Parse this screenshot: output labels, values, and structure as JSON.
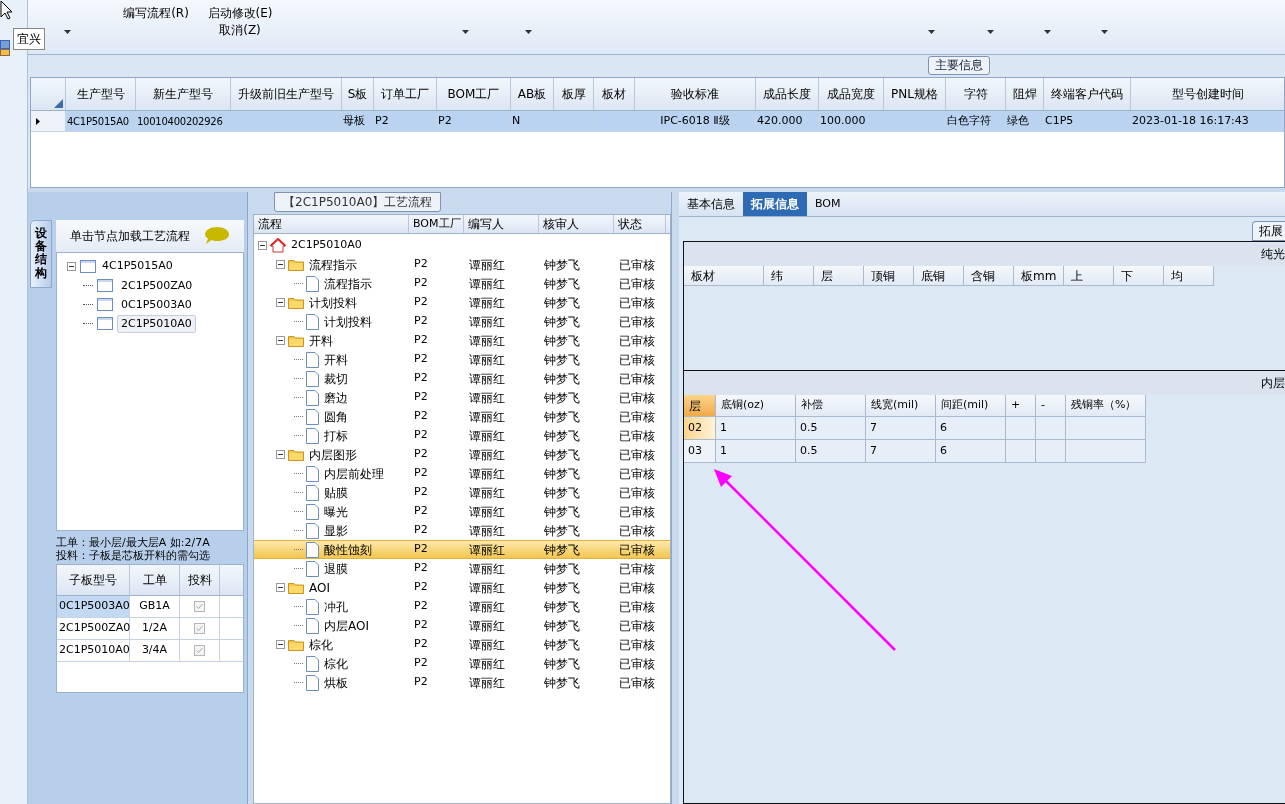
{
  "user_tag": "宜兴",
  "toolbar": {
    "buttons": [
      {
        "label": "编写流程(R)",
        "dropdown": false
      },
      {
        "label": "启动修改(E)",
        "sublabel": "取消(Z)",
        "dropdown": false
      }
    ]
  },
  "main_info": {
    "title": "主要信息",
    "columns": [
      "生产型号",
      "新生产型号",
      "升级前旧生产型号",
      "S板",
      "订单工厂",
      "BOM工厂",
      "AB板",
      "板厚",
      "板材",
      "验收标准",
      "成品长度",
      "成品宽度",
      "PNL规格",
      "字符",
      "阻焊",
      "终端客户代码",
      "型号创建时间"
    ],
    "rows": [
      {
        "selected": true,
        "cells": [
          "4C1P5015A0",
          "10010400202926",
          null,
          "母板",
          "P2",
          "P2",
          "N",
          null,
          null,
          "IPC-6018 Ⅱ级",
          "420.000",
          "100.000",
          null,
          "白色字符",
          "绿色",
          "C1P5",
          "2023-01-18 16:17:43"
        ]
      }
    ]
  },
  "structure_panel": {
    "tab": "设备结构",
    "hint": "单击节点加载工艺流程",
    "tree": [
      {
        "label": "4C1P5015A0",
        "selected": false,
        "expanded": true,
        "children": [
          {
            "label": "2C1P500ZA0",
            "selected": false
          },
          {
            "label": "0C1P5003A0",
            "selected": false
          },
          {
            "label": "2C1P5010A0",
            "selected": true
          }
        ]
      }
    ],
    "notes": [
      "工单：最小层/最大层A 如:2/7A",
      "投料：子板是芯板开料的需勾选"
    ],
    "columns": [
      "子板型号",
      "工单",
      "投料"
    ],
    "rows": [
      {
        "model": "0C1P5003A0",
        "order": "GB1A",
        "feed": true,
        "selected": true
      },
      {
        "model": "2C1P500ZA0",
        "order": "1/2A",
        "feed": true,
        "selected": false
      },
      {
        "model": "2C1P5010A0",
        "order": "3/4A",
        "feed": true,
        "selected": false
      }
    ]
  },
  "process_panel": {
    "title": "【2C1P5010A0】工艺流程",
    "columns": [
      "流程",
      "BOM工厂",
      "编写人",
      "核审人",
      "状态"
    ],
    "tree": [
      {
        "label": "2C1P5010A0",
        "kind": "home",
        "expanded": true,
        "selected": false,
        "children": [
          {
            "label": "流程指示",
            "kind": "folder",
            "expanded": true,
            "selected": false,
            "bom": "P2",
            "writer": "谭丽红",
            "reviewer": "钟梦飞",
            "status": "已审核",
            "children": [
              {
                "label": "流程指示",
                "kind": "doc",
                "selected": false,
                "bom": "P2",
                "writer": "谭丽红",
                "reviewer": "钟梦飞",
                "status": "已审核"
              }
            ]
          },
          {
            "label": "计划投料",
            "kind": "folder",
            "expanded": true,
            "selected": false,
            "bom": "P2",
            "writer": "谭丽红",
            "reviewer": "钟梦飞",
            "status": "已审核",
            "children": [
              {
                "label": "计划投料",
                "kind": "doc",
                "selected": false,
                "bom": "P2",
                "writer": "谭丽红",
                "reviewer": "钟梦飞",
                "status": "已审核"
              }
            ]
          },
          {
            "label": "开料",
            "kind": "folder",
            "expanded": true,
            "selected": false,
            "bom": "P2",
            "writer": "谭丽红",
            "reviewer": "钟梦飞",
            "status": "已审核",
            "children": [
              {
                "label": "开料",
                "kind": "doc",
                "selected": false,
                "bom": "P2",
                "writer": "谭丽红",
                "reviewer": "钟梦飞",
                "status": "已审核"
              },
              {
                "label": "裁切",
                "kind": "doc",
                "selected": false,
                "bom": "P2",
                "writer": "谭丽红",
                "reviewer": "钟梦飞",
                "status": "已审核"
              },
              {
                "label": "磨边",
                "kind": "doc",
                "selected": false,
                "bom": "P2",
                "writer": "谭丽红",
                "reviewer": "钟梦飞",
                "status": "已审核"
              },
              {
                "label": "圆角",
                "kind": "doc",
                "selected": false,
                "bom": "P2",
                "writer": "谭丽红",
                "reviewer": "钟梦飞",
                "status": "已审核"
              },
              {
                "label": "打标",
                "kind": "doc",
                "selected": false,
                "bom": "P2",
                "writer": "谭丽红",
                "reviewer": "钟梦飞",
                "status": "已审核"
              }
            ]
          },
          {
            "label": "内层图形",
            "kind": "folder",
            "expanded": true,
            "selected": false,
            "bom": "P2",
            "writer": "谭丽红",
            "reviewer": "钟梦飞",
            "status": "已审核",
            "children": [
              {
                "label": "内层前处理",
                "kind": "doc",
                "selected": false,
                "bom": "P2",
                "writer": "谭丽红",
                "reviewer": "钟梦飞",
                "status": "已审核"
              },
              {
                "label": "贴膜",
                "kind": "doc",
                "selected": false,
                "bom": "P2",
                "writer": "谭丽红",
                "reviewer": "钟梦飞",
                "status": "已审核"
              },
              {
                "label": "曝光",
                "kind": "doc",
                "selected": false,
                "bom": "P2",
                "writer": "谭丽红",
                "reviewer": "钟梦飞",
                "status": "已审核"
              },
              {
                "label": "显影",
                "kind": "doc",
                "selected": false,
                "bom": "P2",
                "writer": "谭丽红",
                "reviewer": "钟梦飞",
                "status": "已审核"
              },
              {
                "label": "酸性蚀刻",
                "kind": "doc",
                "selected": true,
                "bom": "P2",
                "writer": "谭丽红",
                "reviewer": "钟梦飞",
                "status": "已审核"
              },
              {
                "label": "退膜",
                "kind": "doc",
                "selected": false,
                "bom": "P2",
                "writer": "谭丽红",
                "reviewer": "钟梦飞",
                "status": "已审核"
              }
            ]
          },
          {
            "label": "AOI",
            "kind": "folder",
            "expanded": true,
            "selected": false,
            "bom": "P2",
            "writer": "谭丽红",
            "reviewer": "钟梦飞",
            "status": "已审核",
            "children": [
              {
                "label": "冲孔",
                "kind": "doc",
                "selected": false,
                "bom": "P2",
                "writer": "谭丽红",
                "reviewer": "钟梦飞",
                "status": "已审核"
              },
              {
                "label": "内层AOI",
                "kind": "doc",
                "selected": false,
                "bom": "P2",
                "writer": "谭丽红",
                "reviewer": "钟梦飞",
                "status": "已审核"
              }
            ]
          },
          {
            "label": "棕化",
            "kind": "folder",
            "expanded": true,
            "selected": false,
            "bom": "P2",
            "writer": "谭丽红",
            "reviewer": "钟梦飞",
            "status": "已审核",
            "children": [
              {
                "label": "棕化",
                "kind": "doc",
                "selected": false,
                "bom": "P2",
                "writer": "谭丽红",
                "reviewer": "钟梦飞",
                "status": "已审核"
              },
              {
                "label": "烘板",
                "kind": "doc",
                "selected": false,
                "bom": "P2",
                "writer": "谭丽红",
                "reviewer": "钟梦飞",
                "status": "已审核"
              }
            ]
          }
        ]
      }
    ]
  },
  "detail_panel": {
    "tabs": [
      {
        "label": "基本信息",
        "selected": false
      },
      {
        "label": "拓展信息",
        "selected": true
      },
      {
        "label": "BOM",
        "selected": false
      }
    ],
    "side_tab": "拓展",
    "plain_board": {
      "title": "纯光",
      "columns": [
        "板材",
        "纬",
        "层",
        "顶铜",
        "底铜",
        "含铜",
        "板mm",
        "上",
        "下",
        "均"
      ]
    },
    "inner_etch": {
      "title": "内层",
      "columns": [
        "层",
        "底铜(oz)",
        "补偿",
        "线宽(mil)",
        "间距(mil)",
        "+",
        "-",
        "残铜率（%）"
      ],
      "rows": [
        {
          "selected": true,
          "cells": [
            "02",
            "1",
            "0.5",
            "7",
            "6"
          ]
        },
        {
          "selected": false,
          "cells": [
            "03",
            "1",
            "0.5",
            "7",
            "6"
          ]
        }
      ]
    }
  },
  "annotation": {
    "kind": "arrow"
  }
}
